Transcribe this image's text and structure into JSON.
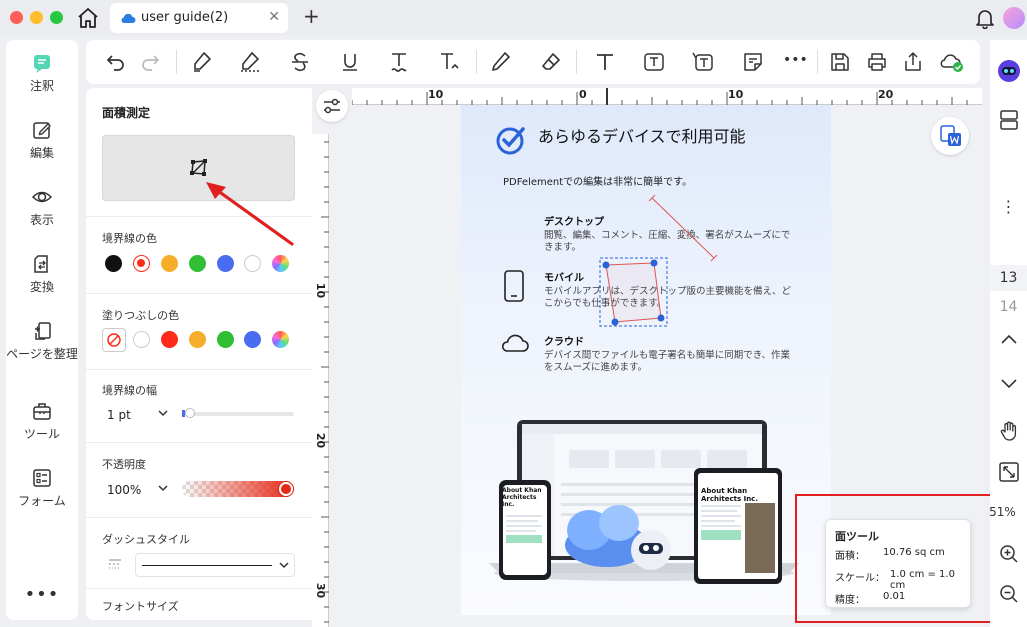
{
  "titlebar": {
    "tab_title": "user guide(2)",
    "close_glyph": "✕",
    "new_tab_glyph": "+"
  },
  "leftnav": {
    "items": [
      {
        "label": "注釈",
        "icon": "annotate-icon"
      },
      {
        "label": "編集",
        "icon": "edit-icon"
      },
      {
        "label": "表示",
        "icon": "view-icon"
      },
      {
        "label": "変換",
        "icon": "convert-icon"
      },
      {
        "label": "ページを整理",
        "icon": "organize-pages-icon"
      },
      {
        "label": "ツール",
        "icon": "tools-icon"
      },
      {
        "label": "フォーム",
        "icon": "form-icon"
      }
    ],
    "more": "•••"
  },
  "toolbar": {
    "items": [
      "undo-icon",
      "redo-icon",
      "highlighter-icon",
      "area-highlight-icon",
      "strikethrough-icon",
      "underline-icon",
      "squiggly-icon",
      "replace-text-icon",
      "pencil-icon",
      "eraser-icon",
      "text-icon",
      "text-box-icon",
      "callout-icon",
      "sticky-note-icon",
      "more-icon",
      "save-icon",
      "print-icon",
      "share-icon",
      "cloud-sync-icon"
    ],
    "more_glyph": "•••"
  },
  "panel": {
    "title": "面積測定",
    "border_color_label": "境界線の色",
    "fill_color_label": "塗りつぶしの色",
    "border_width_label": "境界線の幅",
    "border_width_value": "1 pt",
    "opacity_label": "不透明度",
    "opacity_value": "100%",
    "dash_style_label": "ダッシュスタイル",
    "font_size_label": "フォントサイズ",
    "border_colors": [
      "#111111",
      "#ff2a1a",
      "#f5ad2a",
      "#2fbe34",
      "#4a6cf0",
      "#ffffff"
    ],
    "fill_colors": [
      "#ffffff",
      "#ff2a1a",
      "#f5ad2a",
      "#2fbe34",
      "#4a6cf0"
    ],
    "accent": "#e02020"
  },
  "ruler": {
    "top_labels": [
      "10",
      "0",
      "10",
      "20"
    ],
    "left_labels": [
      "10",
      "20",
      "30"
    ]
  },
  "page": {
    "heading": "あらゆるデバイスで利用可能",
    "sub": "PDFelementでの編集は非常に簡単です。",
    "features": [
      {
        "title": "デスクトップ",
        "desc": "閲覧、編集、コメント、圧縮、変換、署名がスムーズにできます。"
      },
      {
        "title": "モバイル",
        "desc": "モバイルアプリは、デスクトップ版の主要機能を備え、どこからでも仕事ができます。"
      },
      {
        "title": "クラウド",
        "desc": "デバイス間でファイルも電子署名も簡単に同期でき、作業をスムーズに進めます。"
      }
    ],
    "device_text": "About Khan Architects Inc."
  },
  "measure": {
    "title": "面ツール",
    "area_label": "面積：",
    "area_value": "10.76 sq cm",
    "scale_label": "スケール：",
    "scale_value": "1.0 cm = 1.0 cm",
    "precision_label": "精度：",
    "precision_value": "0.01"
  },
  "rightbar": {
    "page_current": "13",
    "page_next": "14",
    "zoom": "51%",
    "more_glyph": "⋮"
  }
}
